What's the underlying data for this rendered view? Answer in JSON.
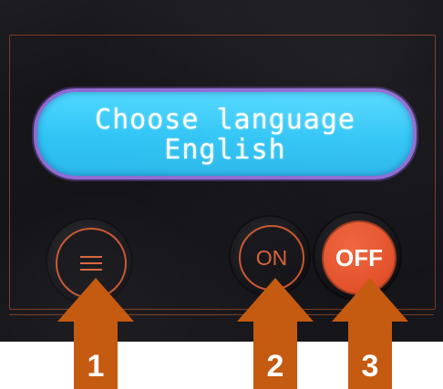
{
  "lcd": {
    "line1": "Choose language",
    "line2": "English"
  },
  "buttons": {
    "menu_icon": "menu-icon",
    "on_label": "ON",
    "off_label": "OFF"
  },
  "callouts": {
    "arrow1": "1",
    "arrow2": "2",
    "arrow3": "3"
  },
  "colors": {
    "lcd_bg": "#2dc4f5",
    "lcd_border": "#8d69d2",
    "button_accent": "#d8603a",
    "off_fill": "#e2512b",
    "arrow": "#c55a11"
  }
}
